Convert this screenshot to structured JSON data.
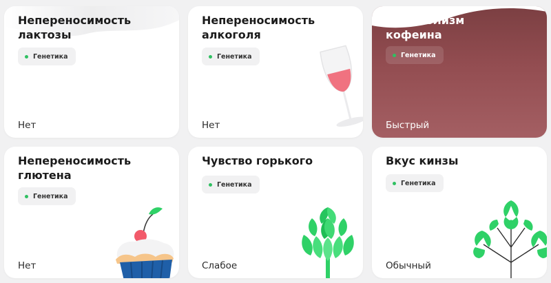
{
  "cards": [
    {
      "title": "Непереносимость лактозы",
      "tag": "Генетика",
      "result": "Нет"
    },
    {
      "title": "Непереносимость алкоголя",
      "tag": "Генетика",
      "result": "Нет"
    },
    {
      "title": "Метаболизм кофеина",
      "tag": "Генетика",
      "result": "Быстрый"
    },
    {
      "title": "Непереносимость глютена",
      "tag": "Генетика",
      "result": "Нет"
    },
    {
      "title": "Чувство горького",
      "tag": "Генетика",
      "result": "Слабое"
    },
    {
      "title": "Вкус кинзы",
      "tag": "Генетика",
      "result": "Обычный"
    }
  ],
  "icons": [
    "milk-splash-icon",
    "wine-glass-icon",
    "coffee-wave-icon",
    "cupcake-cherry-icon",
    "hops-plant-icon",
    "cilantro-plant-icon"
  ],
  "colors": {
    "accent_green": "#2fc061",
    "coffee_card": "#934d51",
    "wine": "#f07280",
    "leaf": "#2fd167"
  }
}
